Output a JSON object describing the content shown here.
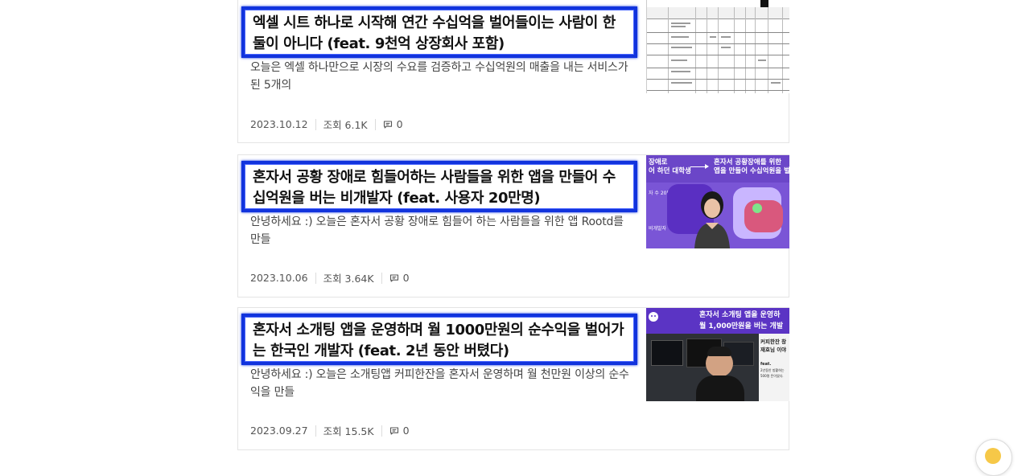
{
  "posts": [
    {
      "title": "엑셀 시트 하나로 시작해 연간 수십억을 벌어들이는 사람이 한둘이 아니다 (feat. 9천억 상장회사 포함)",
      "summary": "오늘은 엑셀 하나만으로 시장의 수요를 검증하고 수십억원의 매출을 내는 서비스가 된 5개의",
      "date": "2023.10.12",
      "views": "조회 6.1K",
      "comments": "0",
      "thumbnail_icon": "spreadsheet-thumbnail"
    },
    {
      "title": "혼자서 공황 장애로 힘들어하는 사람들을 위한 앱을 만들어 수십억원을 버는 비개발자 (feat. 사용자 20만명)",
      "summary": "안녕하세요 :) 오늘은 혼자서 공황 장애로 힘들어 하는 사람들을 위한 앱 Rootd를 만들",
      "date": "2023.10.06",
      "views": "조회 3.64K",
      "comments": "0",
      "thumbnail_icon": "founder-portrait-thumbnail",
      "thumb_text": {
        "left_top": "장애로",
        "left_bottom": "어 하던 대학생",
        "right_top": "혼자서 공황장애를 위한",
        "right_bottom": "앱을 만들어 수십억원을 벌",
        "small": "자 수 20만명",
        "small2": "비개발자"
      }
    },
    {
      "title": "혼자서 소개팅 앱을 운영하며 월 1000만원의 순수익을 벌어가는 한국인 개발자 (feat. 2년 동안 버텼다)",
      "summary": "안녕하세요 :) 오늘은 소개팅앱 커피한잔을 혼자서 운영하며 월 천만원 이상의 순수익을 만들",
      "date": "2023.09.27",
      "views": "조회 15.5K",
      "comments": "0",
      "thumbnail_icon": "developer-photo-thumbnail",
      "thumb_text": {
        "line1": "혼자서 소개팅 앱을 운영하",
        "line2": "월 1,000만원을 버는 개발",
        "panel1": "커피한잔 창",
        "panel2": "재호님 이야",
        "panel3": "feat.",
        "panel4": "2년동안 방황하는",
        "panel5": "500명 돈이었다."
      }
    }
  ],
  "colors": {
    "highlight_border": "#1133dd",
    "card_border": "#e4e4e4",
    "meta_text": "#555555"
  },
  "floating_button_icon": "emoji-face-icon"
}
